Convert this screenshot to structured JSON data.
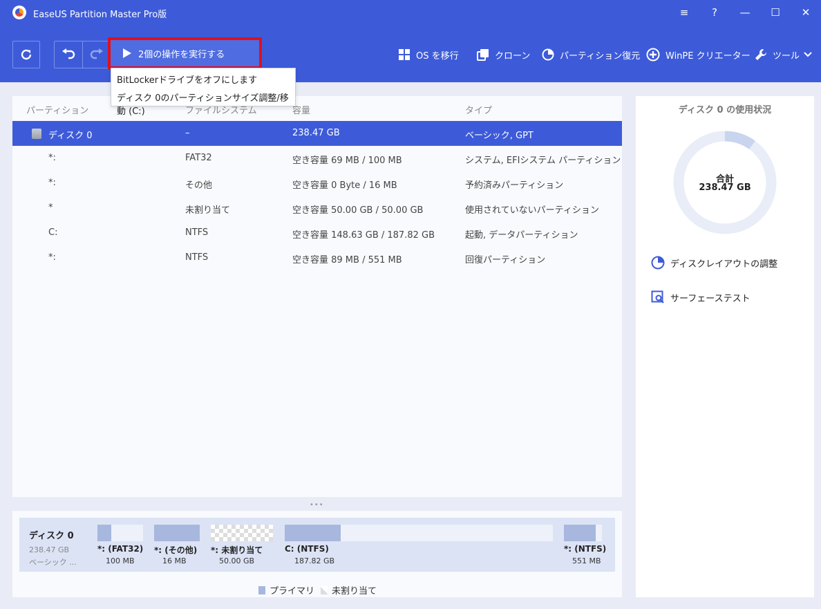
{
  "app": {
    "title": "EaseUS Partition Master Pro版"
  },
  "window_controls": {
    "menu": "≡",
    "help": "?",
    "minimize": "—",
    "maximize": "☐",
    "close": "✕"
  },
  "toolbar": {
    "execute_label": "2個の操作を実行する",
    "items": [
      {
        "label": "OS を移行",
        "icon": "windows-icon"
      },
      {
        "label": "クローン",
        "icon": "clone-icon"
      },
      {
        "label": "パーティション復元",
        "icon": "pie-chart-icon"
      },
      {
        "label": "WinPE クリエーター",
        "icon": "plus-circle-icon"
      },
      {
        "label": "ツール",
        "icon": "wrench-icon"
      }
    ]
  },
  "pending_operations": [
    "BitLockerドライブをオフにします",
    "ディスク 0のパーティションサイズ調整/移動 (C:)"
  ],
  "partition_table": {
    "columns": [
      "パーティション",
      "ファイルシステム",
      "容量",
      "タイプ"
    ],
    "rows": [
      {
        "name": "ディスク 0",
        "fs": "–",
        "capacity": "238.47 GB",
        "type": "ベーシック, GPT",
        "selected": true
      },
      {
        "name": "*:",
        "fs": "FAT32",
        "capacity": "空き容量 69 MB / 100 MB",
        "type": "システム, EFIシステム パーティション"
      },
      {
        "name": "*:",
        "fs": "その他",
        "capacity": "空き容量 0 Byte / 16 MB",
        "type": "予約済みパーティション"
      },
      {
        "name": "*",
        "fs": "未割り当て",
        "capacity": "空き容量 50.00 GB / 50.00 GB",
        "type": "使用されていないパーティション"
      },
      {
        "name": "C:",
        "fs": "NTFS",
        "capacity": "空き容量 148.63 GB / 187.82 GB",
        "type": "起動, データパーティション"
      },
      {
        "name": "*:",
        "fs": "NTFS",
        "capacity": "空き容量 89 MB / 551 MB",
        "type": "回復パーティション"
      }
    ]
  },
  "disk_map": {
    "disk_name": "ディスク 0",
    "disk_size": "238.47 GB",
    "disk_type": "ベーシック ...",
    "partitions": [
      {
        "label": "*: (FAT32)",
        "size": "100 MB",
        "used_fraction": 0.31
      },
      {
        "label": "*: (その他)",
        "size": "16 MB",
        "used_fraction": 1.0
      },
      {
        "label": "*: 未割り当て",
        "size": "50.00 GB",
        "used_fraction": 0
      },
      {
        "label": "C: (NTFS)",
        "size": "187.82 GB",
        "used_fraction": 0.21
      },
      {
        "label": "*: (NTFS)",
        "size": "551 MB",
        "used_fraction": 0.84
      }
    ],
    "legend": [
      "プライマリ",
      "未割り当て"
    ],
    "colors": {
      "primary": "#a7b7dd",
      "unallocated": "#dddddd"
    }
  },
  "side_panel": {
    "title": "ディスク 0 の使用状況",
    "total_label": "合計",
    "total_value": "238.47 GB",
    "used_fraction": 0.1,
    "links": [
      {
        "label": "ディスクレイアウトの調整",
        "icon": "disk-layout-icon"
      },
      {
        "label": "サーフェーステスト",
        "icon": "surface-test-icon"
      }
    ]
  },
  "colors": {
    "accent": "#3d5bd9",
    "highlight_border": "#e10e1b"
  }
}
